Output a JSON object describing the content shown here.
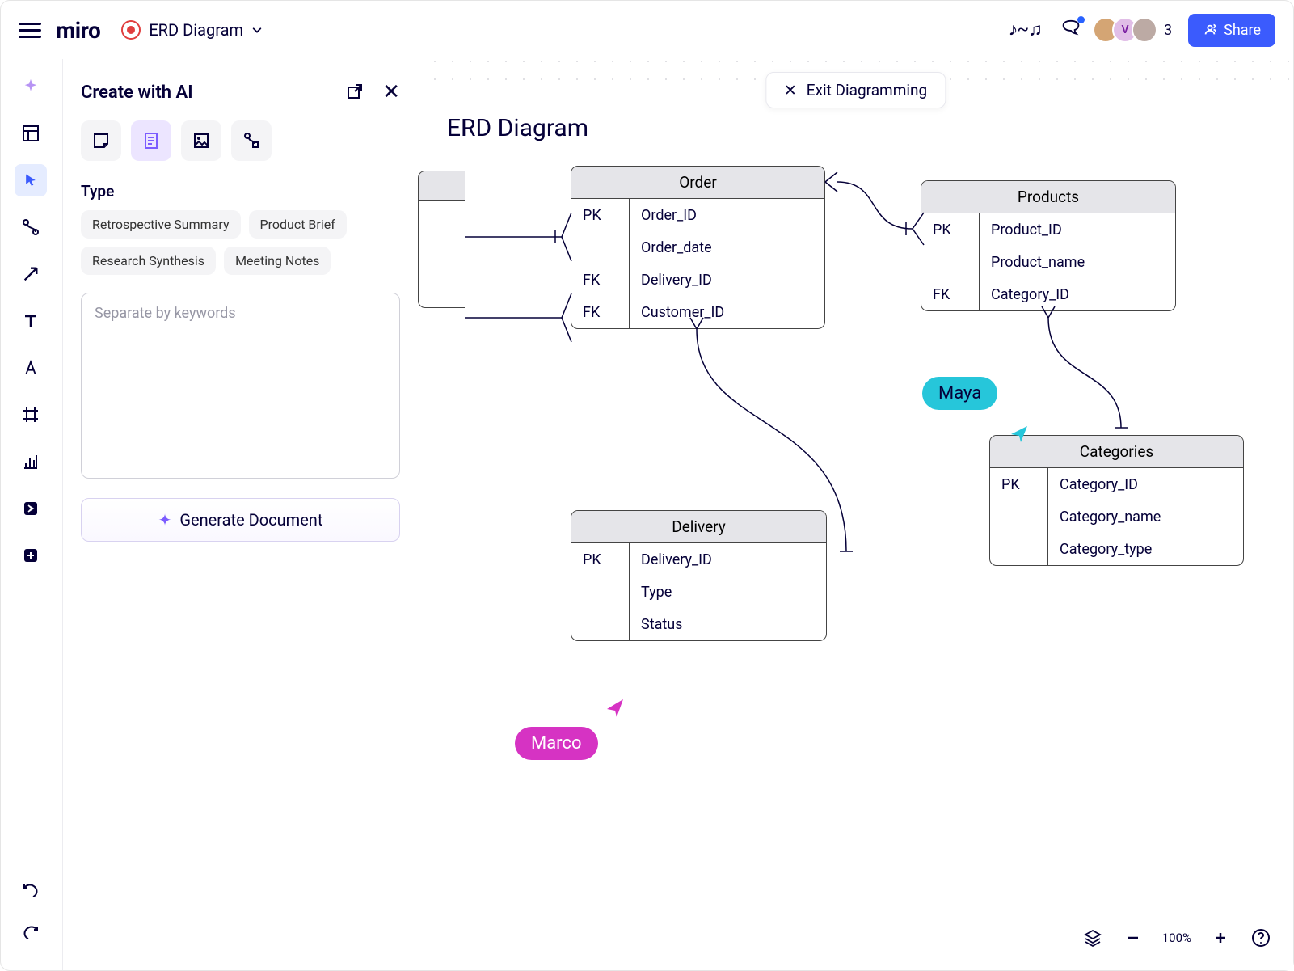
{
  "header": {
    "board_name": "ERD Diagram",
    "collaborator_count": "3",
    "share_label": "Share",
    "avatars": {
      "v_label": "V"
    }
  },
  "toolbar": {
    "items": [
      "ai",
      "template",
      "select",
      "connect",
      "arrow",
      "text",
      "font",
      "frame",
      "chart",
      "brand",
      "add"
    ]
  },
  "ai_panel": {
    "title": "Create with AI",
    "type_label": "Type",
    "chips": [
      "Retrospective Summary",
      "Product Brief",
      "Research Synthesis",
      "Meeting Notes"
    ],
    "placeholder": "Separate by keywords",
    "generate_label": "Generate Document"
  },
  "canvas": {
    "exit_label": "Exit Diagramming",
    "title": "ERD Diagram",
    "entities": {
      "order": {
        "name": "Order",
        "rows": [
          {
            "key": "PK",
            "attr": "Order_ID"
          },
          {
            "key": "",
            "attr": "Order_date"
          },
          {
            "key": "FK",
            "attr": "Delivery_ID"
          },
          {
            "key": "FK",
            "attr": "Customer_ID"
          }
        ]
      },
      "products": {
        "name": "Products",
        "rows": [
          {
            "key": "PK",
            "attr": "Product_ID"
          },
          {
            "key": "",
            "attr": "Product_name"
          },
          {
            "key": "FK",
            "attr": "Category_ID"
          }
        ]
      },
      "categories": {
        "name": "Categories",
        "rows": [
          {
            "key": "PK",
            "attr": "Category_ID"
          },
          {
            "key": "",
            "attr": "Category_name"
          },
          {
            "key": "",
            "attr": "Category_type"
          }
        ]
      },
      "delivery": {
        "name": "Delivery",
        "rows": [
          {
            "key": "PK",
            "attr": "Delivery_ID"
          },
          {
            "key": "",
            "attr": "Type"
          },
          {
            "key": "",
            "attr": "Status"
          }
        ]
      }
    },
    "cursors": {
      "maya": "Maya",
      "marco": "Marco"
    }
  },
  "footer": {
    "zoom": "100%"
  }
}
